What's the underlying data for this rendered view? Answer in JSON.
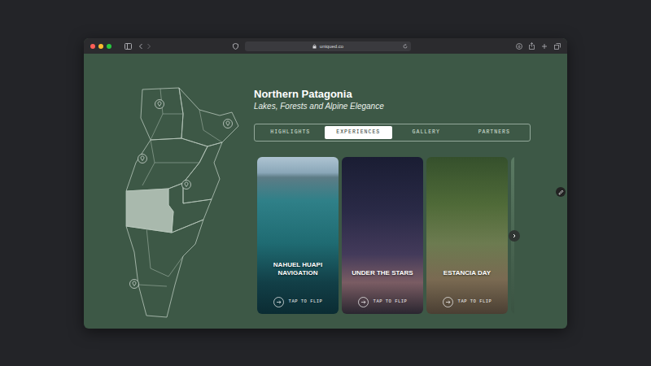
{
  "browser": {
    "url": "uniqued.co"
  },
  "map": {
    "regions": [
      {
        "selected": false
      },
      {
        "selected": false
      },
      {
        "selected": false
      },
      {
        "selected": false
      },
      {
        "selected": true
      },
      {
        "selected": false
      },
      {
        "selected": false
      }
    ]
  },
  "region": {
    "title": "Northern Patagonia",
    "subtitle": "Lakes, Forests and Alpine Elegance"
  },
  "tabs": [
    {
      "label": "HIGHLIGHTS",
      "selected": false
    },
    {
      "label": "EXPERIENCES",
      "selected": true
    },
    {
      "label": "GALLERY",
      "selected": false
    },
    {
      "label": "PARTNERS",
      "selected": false
    }
  ],
  "cards": [
    {
      "title": "NAHUEL HUAPI NAVIGATION",
      "action": "TAP TO FLIP"
    },
    {
      "title": "UNDER THE STARS",
      "action": "TAP TO FLIP"
    },
    {
      "title": "ESTANCIA DAY",
      "action": "TAP TO FLIP"
    }
  ]
}
